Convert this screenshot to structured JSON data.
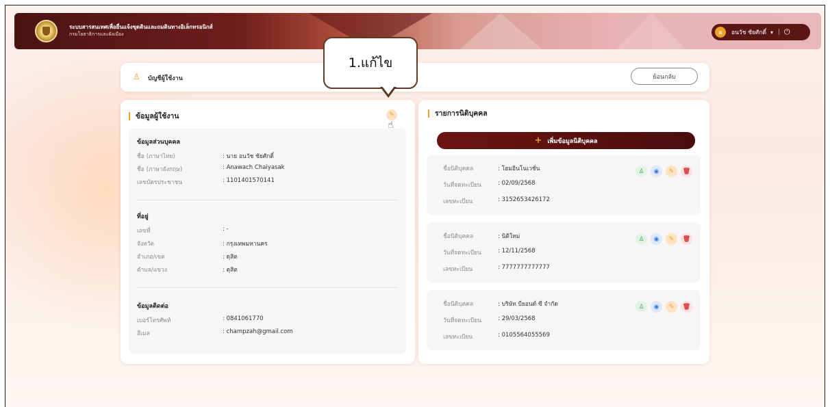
{
  "header": {
    "system_title": "ระบบสารสนเทศเพื่อยื่นแจ้งขุดดินและถมดินทางอิเล็กทรอนิกส์",
    "department": "กรมโยธาธิการและผังเมือง",
    "user_initial": "อ",
    "user_name": "อนวัช ชัยศักดิ์",
    "caret_icon": "▾",
    "separator": "|",
    "power_icon": "⏻"
  },
  "topbar": {
    "account_icon": "♙",
    "account_label": "บัญชีผู้ใช้งาน",
    "back_label": "ย้อนกลับ"
  },
  "callout": {
    "text": "1.แก้ไข"
  },
  "user_info": {
    "title": "ข้อมูลผู้ใช้งาน",
    "edit_icon": "✎",
    "cursor_icon": "☝",
    "personal": {
      "title": "ข้อมูลส่วนบุคคล",
      "rows": [
        {
          "label": "ชื่อ (ภาษาไทย)",
          "value": ": นาย อนวัช ชัยศักดิ์"
        },
        {
          "label": "ชื่อ (ภาษาอังกฤษ)",
          "value": ": Anawach Chaiyasak"
        },
        {
          "label": "เลขบัตรประชาชน",
          "value": ": 1101401570141"
        }
      ]
    },
    "address": {
      "title": "ที่อยู่",
      "rows": [
        {
          "label": "เลขที่",
          "value": ": -"
        },
        {
          "label": "จังหวัด",
          "value": ": กรุงเทพมหานคร"
        },
        {
          "label": "อำเภอ/เขต",
          "value": ": ดุสิต"
        },
        {
          "label": "ตำบล/แขวง",
          "value": ": ดุสิต"
        }
      ]
    },
    "contact": {
      "title": "ข้อมูลติดต่อ",
      "rows": [
        {
          "label": "เบอร์โทรศัพท์",
          "value": ": 0841061770"
        },
        {
          "label": "อีเมล",
          "value": ": champzah@gmail.com"
        }
      ]
    }
  },
  "juristic": {
    "title": "รายการนิติบุคคล",
    "add_icon": "+",
    "add_label": "เพิ่มข้อมูลนิติบุคคล",
    "action_icons": {
      "user": "♙",
      "view": "◉",
      "edit": "✎",
      "delete": "🗑"
    },
    "labels": {
      "name": "ชื่อนิติบุคคล",
      "date": "วันที่จดทะเบียน",
      "reg": "เลขทะเบียน"
    },
    "items": [
      {
        "name": ": โฮมอินโนเวชั่น",
        "date": ": 02/09/2568",
        "reg": ": 3152653426172"
      },
      {
        "name": ": นิติใหม่",
        "date": ": 12/11/2568",
        "reg": ": 7777777777777"
      },
      {
        "name": ": บริษัท บียอนด์ ซี จำกัด",
        "date": ": 29/03/2568",
        "reg": ": 0105564055569"
      }
    ]
  },
  "colors": {
    "brand": "#5a1515",
    "accent": "#f0a022"
  }
}
